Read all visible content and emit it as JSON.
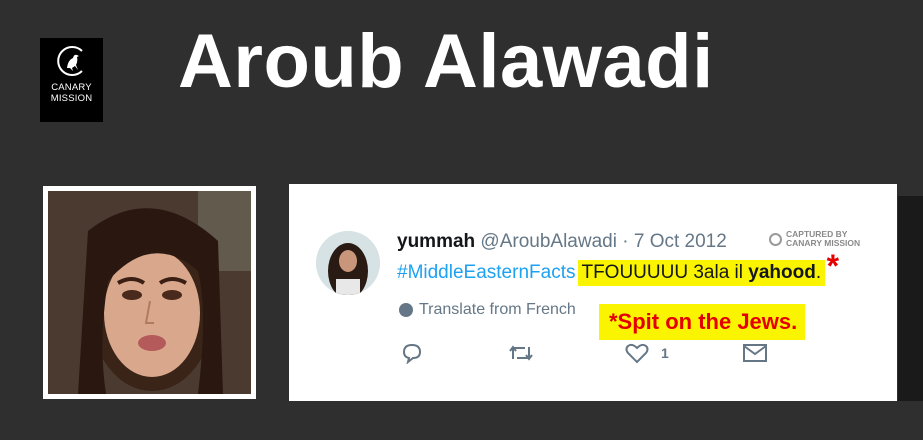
{
  "logo": {
    "line1": "CANARY",
    "line2": "MISSION"
  },
  "title": "Aroub Alawadi",
  "tweet": {
    "display_name": "yummah",
    "handle": "@AroubAlawadi",
    "separator": "·",
    "date": "7 Oct 2012",
    "captured_line1": "CAPTURED BY",
    "captured_line2": "CANARY MISSION",
    "hashtag": "#MiddleEasternFacts",
    "text_part1": "TFOUUUUU 3ala il ",
    "text_bold": "yahood",
    "text_end": ".",
    "star": "*",
    "translate_label": "Translate from French",
    "translation_note": "*Spit on the Jews.",
    "like_count": "1"
  },
  "colors": {
    "background": "#2f2f2f",
    "highlight": "#fbf400",
    "annotation_red": "#e50000",
    "hashtag_blue": "#1da1f2"
  }
}
